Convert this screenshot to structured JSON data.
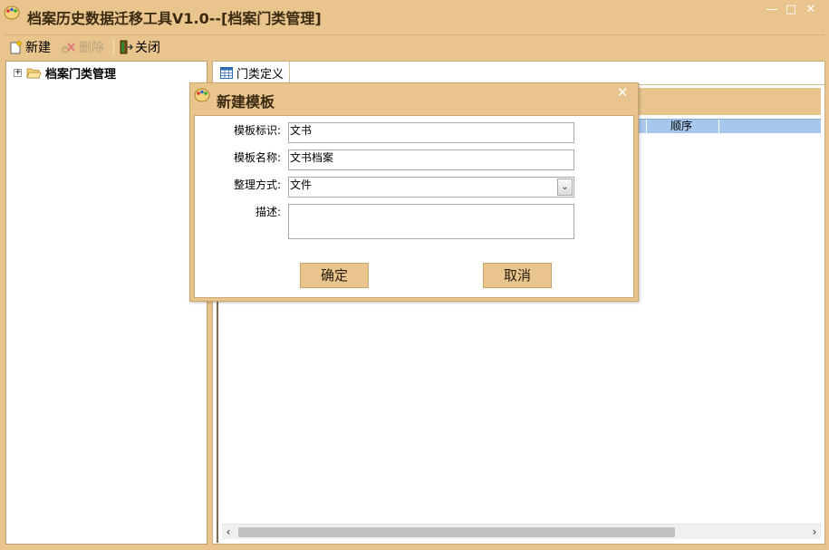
{
  "window": {
    "title": "档案历史数据迁移工具V1.0--[档案门类管理]",
    "controls": {
      "minimize": "—",
      "maximize": "□",
      "close": "✕"
    }
  },
  "toolbar": {
    "new_label": "新建",
    "delete_label": "删除",
    "close_label": "关闭"
  },
  "tree": {
    "root_label": "档案门类管理",
    "expander": "+"
  },
  "tabs": [
    {
      "label": "门类定义"
    }
  ],
  "grid": {
    "columns": [
      {
        "label": "顺序"
      }
    ]
  },
  "scrollbar": {
    "left_arrow": "‹",
    "right_arrow": "›"
  },
  "dialog": {
    "title": "新建模板",
    "close_glyph": "✕",
    "fields": {
      "template_id": {
        "label": "模板标识:",
        "value": "文书"
      },
      "template_name": {
        "label": "模板名称:",
        "value": "文书档案"
      },
      "arrangement": {
        "label": "整理方式:",
        "value": "文件",
        "arrow": "⌄"
      },
      "description": {
        "label": "描述:",
        "value": ""
      }
    },
    "ok_label": "确定",
    "cancel_label": "取消"
  },
  "colors": {
    "chrome": "#e9c48d",
    "grid_header": "#a8c7ec",
    "text": "#000000"
  }
}
